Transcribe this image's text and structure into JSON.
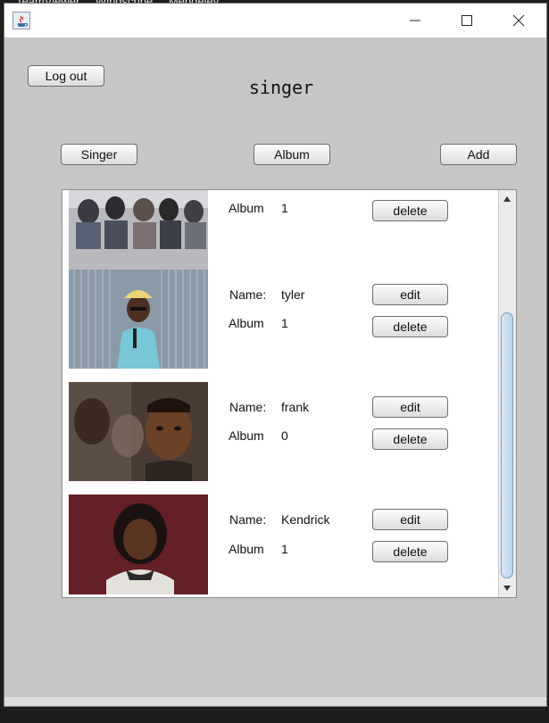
{
  "taskbar_peek": [
    "TeamViewer",
    "Windscribe",
    "Mendeley"
  ],
  "window": {
    "title": "",
    "accent": "#c6c6c6"
  },
  "header": {
    "logout_label": "Log out",
    "page_title": "singer"
  },
  "nav": {
    "singer_label": "Singer",
    "album_label": "Album",
    "add_label": "Add"
  },
  "list": {
    "name_label": "Name:",
    "album_label": "Album",
    "edit_label": "edit",
    "delete_label": "delete",
    "items": [
      {
        "name": "",
        "album": "1"
      },
      {
        "name": "tyler",
        "album": "1"
      },
      {
        "name": "frank",
        "album": "0"
      },
      {
        "name": "Kendrick",
        "album": "1"
      }
    ]
  }
}
